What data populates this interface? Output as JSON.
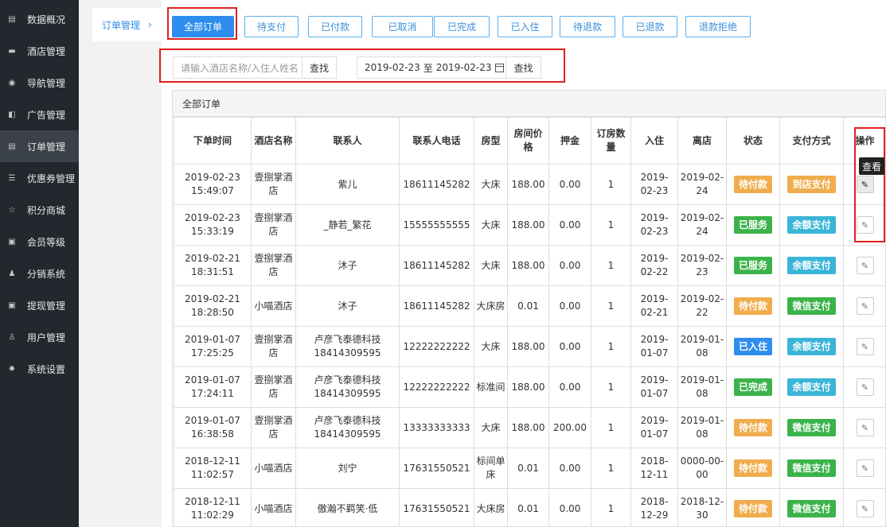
{
  "sidebar": {
    "items": [
      {
        "label": "数据概况",
        "icon": "dashboard-icon",
        "glyph": "▤"
      },
      {
        "label": "酒店管理",
        "icon": "cart-icon",
        "glyph": "▬"
      },
      {
        "label": "导航管理",
        "icon": "compass-icon",
        "glyph": "◉"
      },
      {
        "label": "广告管理",
        "icon": "gift-icon",
        "glyph": "◧"
      },
      {
        "label": "订单管理",
        "icon": "list-icon",
        "glyph": "▤"
      },
      {
        "label": "优惠券管理",
        "icon": "menu-icon",
        "glyph": "☰"
      },
      {
        "label": "积分商城",
        "icon": "star-icon",
        "glyph": "☆"
      },
      {
        "label": "会员等级",
        "icon": "card-icon",
        "glyph": "▣"
      },
      {
        "label": "分销系统",
        "icon": "users-icon",
        "glyph": "♟"
      },
      {
        "label": "提现管理",
        "icon": "money-icon",
        "glyph": "▣"
      },
      {
        "label": "用户管理",
        "icon": "user-icon",
        "glyph": "♙"
      },
      {
        "label": "系统设置",
        "icon": "gear-icon",
        "glyph": "✹"
      }
    ],
    "active_index": 4
  },
  "subnav": {
    "label": "订单管理",
    "chevron": "›"
  },
  "tabs": [
    "全部订单",
    "待支付",
    "已付款",
    "已取消",
    "已完成",
    "已入住",
    "待退款",
    "已退款",
    "退款拒绝"
  ],
  "search": {
    "placeholder": "请输入酒店名称/入住人姓名",
    "button": "查找"
  },
  "date": {
    "start": "2019-02-23",
    "sep": "至",
    "end": "2019-02-23",
    "button": "查找"
  },
  "panel": {
    "title": "全部订单"
  },
  "table": {
    "headers": [
      "下单时间",
      "酒店名称",
      "联系人",
      "联系人电话",
      "房型",
      "房间价格",
      "押金",
      "订房数量",
      "入住",
      "离店",
      "状态",
      "支付方式",
      "操作"
    ],
    "rows": [
      [
        "2019-02-23 15:49:07",
        "壹捌掌酒店",
        "紫儿",
        "18611145282",
        "大床",
        "188.00",
        "0.00",
        "1",
        "2019-02-23",
        "2019-02-24",
        "待付款",
        "到店支付"
      ],
      [
        "2019-02-23 15:33:19",
        "壹捌掌酒店",
        "_静若_繁花",
        "15555555555",
        "大床",
        "188.00",
        "0.00",
        "1",
        "2019-02-23",
        "2019-02-24",
        "已服务",
        "余额支付"
      ],
      [
        "2019-02-21 18:31:51",
        "壹捌掌酒店",
        "沐子",
        "18611145282",
        "大床",
        "188.00",
        "0.00",
        "1",
        "2019-02-22",
        "2019-02-23",
        "已服务",
        "余额支付"
      ],
      [
        "2019-02-21 18:28:50",
        "小喵酒店",
        "沐子",
        "18611145282",
        "大床房",
        "0.01",
        "0.00",
        "1",
        "2019-02-21",
        "2019-02-22",
        "待付款",
        "微信支付"
      ],
      [
        "2019-01-07 17:25:25",
        "壹捌掌酒店",
        "卢彦飞泰德科技 18414309595",
        "12222222222",
        "大床",
        "188.00",
        "0.00",
        "1",
        "2019-01-07",
        "2019-01-08",
        "已入住",
        "余额支付"
      ],
      [
        "2019-01-07 17:24:11",
        "壹捌掌酒店",
        "卢彦飞泰德科技 18414309595",
        "12222222222",
        "标准间",
        "188.00",
        "0.00",
        "1",
        "2019-01-07",
        "2019-01-08",
        "已完成",
        "余额支付"
      ],
      [
        "2019-01-07 16:38:58",
        "壹捌掌酒店",
        "卢彦飞泰德科技 18414309595",
        "13333333333",
        "大床",
        "188.00",
        "200.00",
        "1",
        "2019-01-07",
        "2019-01-08",
        "待付款",
        "微信支付"
      ],
      [
        "2018-12-11 11:02:57",
        "小喵酒店",
        "刘宁",
        "17631550521",
        "标间单床",
        "0.01",
        "0.00",
        "1",
        "2018-12-11",
        "0000-00-00",
        "待付款",
        "微信支付"
      ],
      [
        "2018-12-11 11:02:29",
        "小喵酒店",
        "傲瀚不羁笑·低",
        "17631550521",
        "大床房",
        "0.01",
        "0.00",
        "1",
        "2018-12-29",
        "2018-12-30",
        "待付款",
        "微信支付"
      ]
    ],
    "edit_icon": "pencil-icon"
  },
  "tooltip": "查看",
  "colors": {
    "primary": "#2e8ded",
    "status": {
      "待付款": "#f0ad4e",
      "已服务": "#3bb34a",
      "已入住": "#2e8ded",
      "已完成": "#3bb34a"
    },
    "payment": {
      "到店支付": "#f0ad4e",
      "余额支付": "#3ab5d8",
      "微信支付": "#3bb34a"
    },
    "highlight_box": "#e02020",
    "sidebar_bg": "#22282e"
  }
}
